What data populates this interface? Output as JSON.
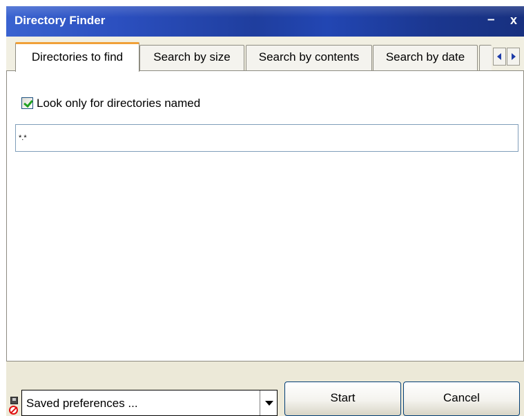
{
  "window": {
    "title": "Directory Finder",
    "minimize_glyph": "–",
    "close_glyph": "x"
  },
  "tabs": [
    {
      "label": "Directories to find",
      "active": true
    },
    {
      "label": "Search by size",
      "active": false
    },
    {
      "label": "Search by contents",
      "active": false
    },
    {
      "label": "Search by date",
      "active": false
    }
  ],
  "tab_scroll": {
    "left_icon": "chevron-left-icon",
    "right_icon": "chevron-right-icon"
  },
  "options": {
    "look_only_named": {
      "label": "Look only for directories named",
      "checked": true
    },
    "name_pattern": {
      "value": "*.*"
    }
  },
  "footer": {
    "saved_icon": "disk-no-entry-icon",
    "saved_preferences": {
      "value": "Saved preferences ..."
    },
    "start_label": "Start",
    "cancel_label": "Cancel"
  },
  "colors": {
    "titlebar": "#2246b3",
    "active_tab_accent": "#f0a038",
    "checkmark": "#21a121",
    "button_border": "#003c74"
  }
}
